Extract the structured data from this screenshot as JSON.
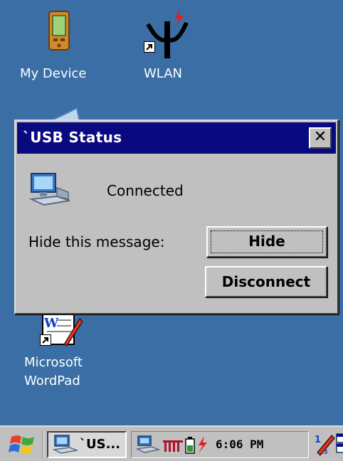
{
  "desktop": {
    "icons": [
      {
        "label": "My Device",
        "icon": "pda-device-icon"
      },
      {
        "label": "WLAN",
        "icon": "wlan-antenna-icon"
      },
      {
        "label_line1": "Microsoft",
        "label_line2": "WordPad",
        "icon": "wordpad-icon"
      }
    ]
  },
  "dialog": {
    "title": "`USB Status",
    "close_label": "✕",
    "status": "Connected",
    "hide_prompt": "Hide this message:",
    "hide_button": "Hide",
    "disconnect_button": "Disconnect"
  },
  "taskbar": {
    "task_label": "`US...",
    "clock": "6:06 PM"
  },
  "colors": {
    "desktop": "#3a6ea5",
    "titlebar": "#0a0a80",
    "window": "#c0c0c0"
  }
}
